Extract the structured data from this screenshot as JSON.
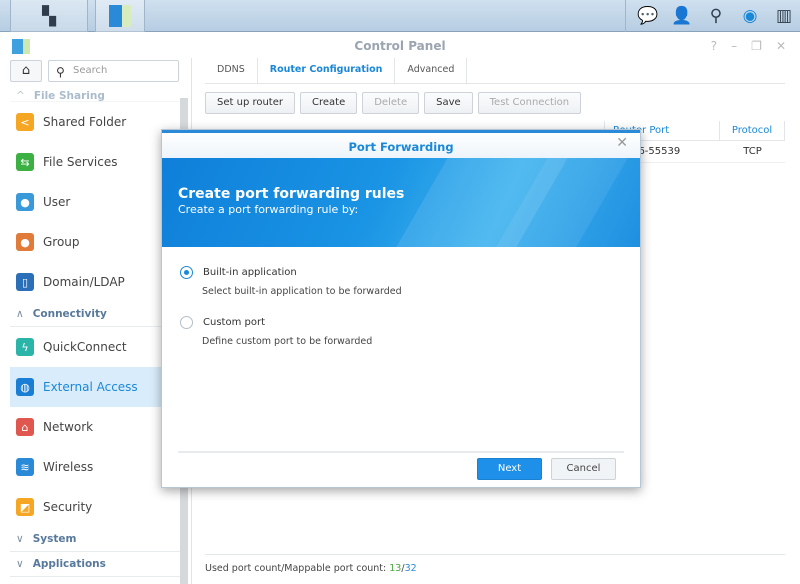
{
  "taskbar": {
    "icons": [
      "main-menu-icon",
      "control-panel-icon",
      "notification-icon",
      "user-icon",
      "search-icon",
      "dsm-help-icon",
      "widgets-icon"
    ]
  },
  "window": {
    "title": "Control Panel",
    "controls": [
      "?",
      "–",
      "❐",
      "✕"
    ]
  },
  "sidebar": {
    "search_placeholder": "Search",
    "partial_section": "File Sharing",
    "items_top": [
      {
        "label": "Shared Folder",
        "icon": "shared-folder-icon",
        "color": "#f5a623"
      },
      {
        "label": "File Services",
        "icon": "file-services-icon",
        "color": "#3cb043"
      },
      {
        "label": "User",
        "icon": "user-icon",
        "color": "#3a9ad9"
      },
      {
        "label": "Group",
        "icon": "group-icon",
        "color": "#e07b39"
      },
      {
        "label": "Domain/LDAP",
        "icon": "domain-ldap-icon",
        "color": "#2a6fb8"
      }
    ],
    "section_connectivity": "Connectivity",
    "items_conn": [
      {
        "label": "QuickConnect",
        "icon": "quickconnect-icon",
        "color": "#2bb5a8"
      },
      {
        "label": "External Access",
        "icon": "external-access-icon",
        "color": "#1a7fd4",
        "active": true
      },
      {
        "label": "Network",
        "icon": "network-icon",
        "color": "#e0574f"
      },
      {
        "label": "Wireless",
        "icon": "wireless-icon",
        "color": "#2a8ad8"
      },
      {
        "label": "Security",
        "icon": "security-icon",
        "color": "#f5a623"
      }
    ],
    "section_system": "System",
    "section_applications": "Applications"
  },
  "main": {
    "tabs": [
      "DDNS",
      "Router Configuration",
      "Advanced"
    ],
    "active_tab": "Router Configuration",
    "toolbar": {
      "setup": "Set up router",
      "create": "Create",
      "delete": "Delete",
      "save": "Save",
      "test": "Test Connection"
    },
    "grid": {
      "headers": [
        "Router Port",
        "Protocol"
      ],
      "rows": [
        {
          "router_port": "55536-55539",
          "protocol": "TCP"
        }
      ]
    },
    "footer": {
      "label": "Used port count/Mappable port count:",
      "used": "13",
      "sep": "/",
      "max": "32"
    }
  },
  "dialog": {
    "title": "Port Forwarding",
    "heading": "Create port forwarding rules",
    "subheading": "Create a port forwarding rule by:",
    "options": [
      {
        "label": "Built-in application",
        "desc": "Select built-in application to be forwarded",
        "selected": true
      },
      {
        "label": "Custom port",
        "desc": "Define custom port to be forwarded",
        "selected": false
      }
    ],
    "next": "Next",
    "cancel": "Cancel"
  }
}
